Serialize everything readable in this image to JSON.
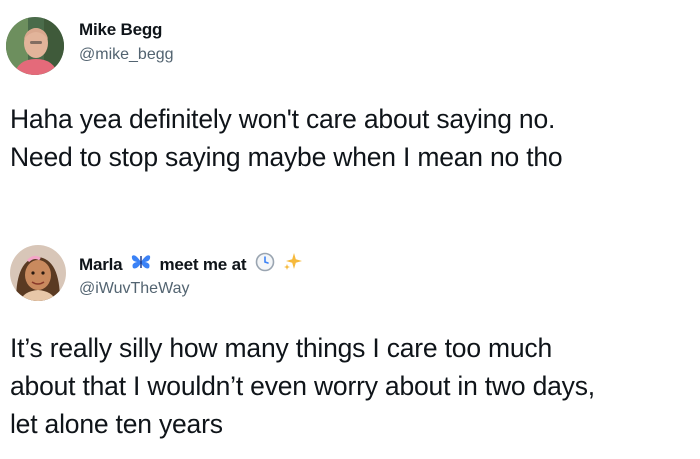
{
  "tweets": [
    {
      "display_name": "Mike Begg",
      "handle": "@mike_begg",
      "text": "Haha yea definitely won't care about saying no.\nNeed to stop saying maybe when I mean no tho"
    },
    {
      "display_name_part1": "Marla",
      "display_name_part2": "meet me at",
      "handle": "@iWuvTheWay",
      "text": "It’s really silly how many things I care too much\nabout that I wouldn’t even worry about in two days,\nlet alone ten years",
      "name_emojis": [
        "butterfly-icon",
        "clock-icon",
        "sparkles-icon"
      ]
    }
  ],
  "colors": {
    "text": "#0f1419",
    "handle": "#536471",
    "butterfly": "#3b82f6",
    "sparkle": "#f6b93b"
  }
}
